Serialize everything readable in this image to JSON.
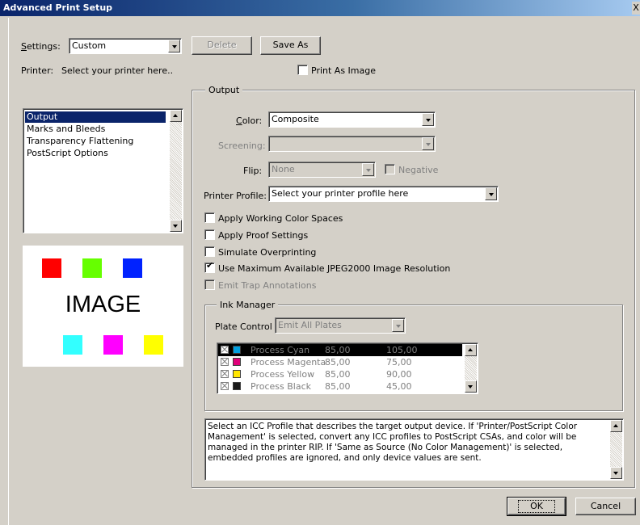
{
  "window": {
    "title": "Advanced Print Setup",
    "close": "X"
  },
  "settings": {
    "label": "Settings:",
    "value": "Custom",
    "delete_label": "Delete",
    "save_as_label": "Save As"
  },
  "printer": {
    "label": "Printer:",
    "value": "Select your printer here..",
    "print_as_image": "Print As Image",
    "print_as_image_checked": false
  },
  "sidebar": {
    "items": [
      {
        "label": "Output",
        "selected": true
      },
      {
        "label": "Marks and Bleeds",
        "selected": false
      },
      {
        "label": "Transparency Flattening",
        "selected": false
      },
      {
        "label": "PostScript Options",
        "selected": false
      }
    ]
  },
  "preview": {
    "label": "IMAGE",
    "top_swatches": [
      "#ff0000",
      "#66ff00",
      "#0022ff"
    ],
    "bottom_swatches": [
      "#33ffff",
      "#ff00ff",
      "#ffff00"
    ]
  },
  "output": {
    "legend": "Output",
    "color_label": "Color:",
    "color_value": "Composite",
    "screening_label": "Screening:",
    "screening_value": "",
    "flip_label": "Flip:",
    "flip_value": "None",
    "negative_label": "Negative",
    "printer_profile_label": "Printer Profile:",
    "printer_profile_value": "Select your printer profile here",
    "options": [
      {
        "label": "Apply Working Color Spaces",
        "checked": false,
        "enabled": true
      },
      {
        "label": "Apply Proof Settings",
        "checked": false,
        "enabled": true
      },
      {
        "label": "Simulate Overprinting",
        "checked": false,
        "enabled": true
      },
      {
        "label": "Use Maximum Available JPEG2000 Image Resolution",
        "checked": true,
        "enabled": true
      },
      {
        "label": "Emit Trap Annotations",
        "checked": false,
        "enabled": false
      }
    ]
  },
  "ink_manager": {
    "legend": "Ink Manager",
    "plate_control_label": "Plate Control",
    "plate_control_value": "Emit All Plates",
    "inks": [
      {
        "name": "Process Cyan",
        "col1": "85,00",
        "col2": "105,00",
        "color": "#00a0e0",
        "selected": true
      },
      {
        "name": "Process Magenta",
        "col1": "85,00",
        "col2": "75,00",
        "color": "#e0007a",
        "selected": false
      },
      {
        "name": "Process Yellow",
        "col1": "85,00",
        "col2": "90,00",
        "color": "#ffe600",
        "selected": false
      },
      {
        "name": "Process Black",
        "col1": "85,00",
        "col2": "45,00",
        "color": "#1a1a1a",
        "selected": false
      }
    ]
  },
  "description": "Select an ICC Profile that describes the target output device. If 'Printer/PostScript Color Management' is selected, convert any ICC profiles to PostScript CSAs, and color will be managed in the printer RIP. If 'Same as Source (No Color Management)' is selected, embedded profiles are ignored, and only device values are sent.",
  "footer": {
    "ok_label": "OK",
    "cancel_label": "Cancel"
  }
}
